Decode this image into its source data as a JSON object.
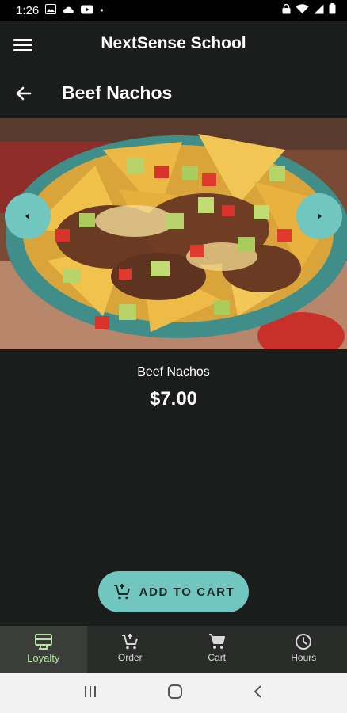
{
  "status_bar": {
    "time": "1:26",
    "dot": "•"
  },
  "app_bar": {
    "title": "NextSense School"
  },
  "page": {
    "title": "Beef Nachos"
  },
  "product": {
    "name": "Beef Nachos",
    "price": "$7.00"
  },
  "actions": {
    "add_to_cart": "ADD TO CART"
  },
  "bottom_nav": [
    {
      "label": "Loyalty",
      "icon": "loyalty-icon",
      "active": true
    },
    {
      "label": "Order",
      "icon": "order-icon",
      "active": false
    },
    {
      "label": "Cart",
      "icon": "cart-icon",
      "active": false
    },
    {
      "label": "Hours",
      "icon": "clock-icon",
      "active": false
    }
  ],
  "colors": {
    "accent": "#72c6c0",
    "active_nav": "#b7e4a4",
    "background": "#1b1c1c"
  }
}
